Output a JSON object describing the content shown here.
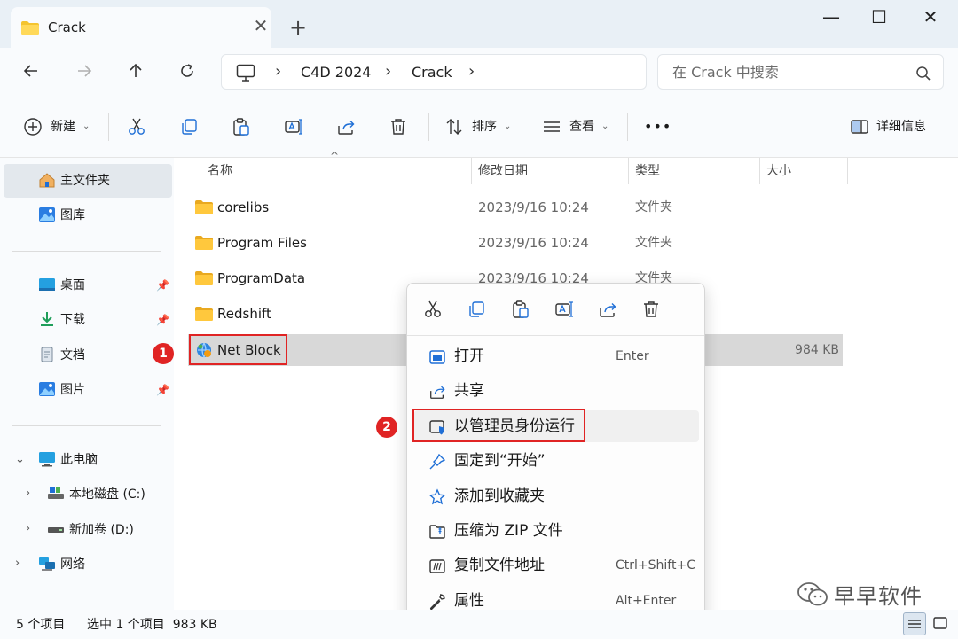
{
  "window": {
    "tab_title": "Crack",
    "new_tab": "+",
    "tab_close": "✕",
    "minimize": "—",
    "maximize": "☐",
    "close": "✕"
  },
  "address": {
    "crumbs": [
      "C4D 2024",
      "Crack"
    ],
    "separator": "›",
    "search_placeholder": "在 Crack 中搜索"
  },
  "toolbar": {
    "new_label": "新建",
    "sort_label": "排序",
    "view_label": "查看",
    "more_label": "•••",
    "details_label": "详细信息",
    "caret": "⌄"
  },
  "sidebar": {
    "home": "主文件夹",
    "gallery": "图库",
    "desktop": "桌面",
    "downloads": "下载",
    "documents": "文档",
    "pictures": "图片",
    "this_pc": "此电脑",
    "local_disk": "本地磁盘 (C:)",
    "new_volume": "新加卷 (D:)",
    "network": "网络"
  },
  "columns": {
    "name": "名称",
    "modified": "修改日期",
    "type": "类型",
    "size": "大小"
  },
  "files": [
    {
      "name": "corelibs",
      "date": "2023/9/16 10:24",
      "type": "文件夹",
      "size": ""
    },
    {
      "name": "Program Files",
      "date": "2023/9/16 10:24",
      "type": "文件夹",
      "size": ""
    },
    {
      "name": "ProgramData",
      "date": "2023/9/16 10:24",
      "type": "文件夹",
      "size": ""
    },
    {
      "name": "Redshift",
      "date": "",
      "type": "",
      "size": ""
    },
    {
      "name": "Net Block",
      "date": "",
      "type": "",
      "size": "984 KB"
    }
  ],
  "steps": [
    "1",
    "2"
  ],
  "context_menu": {
    "items": [
      {
        "label": "打开",
        "shortcut": "Enter"
      },
      {
        "label": "共享",
        "shortcut": ""
      },
      {
        "label": "以管理员身份运行",
        "shortcut": ""
      },
      {
        "label": "固定到“开始”",
        "shortcut": ""
      },
      {
        "label": "添加到收藏夹",
        "shortcut": ""
      },
      {
        "label": "压缩为 ZIP 文件",
        "shortcut": ""
      },
      {
        "label": "复制文件地址",
        "shortcut": "Ctrl+Shift+C"
      },
      {
        "label": "属性",
        "shortcut": "Alt+Enter"
      }
    ]
  },
  "status": {
    "item_count": "5 个项目",
    "selection": "选中 1 个项目  983 KB"
  },
  "watermark": {
    "text": "早早软件"
  },
  "colors": {
    "highlight_red": "#e02424",
    "accent_blue": "#1f6fd6",
    "folder_yellow": "#f4c430"
  }
}
